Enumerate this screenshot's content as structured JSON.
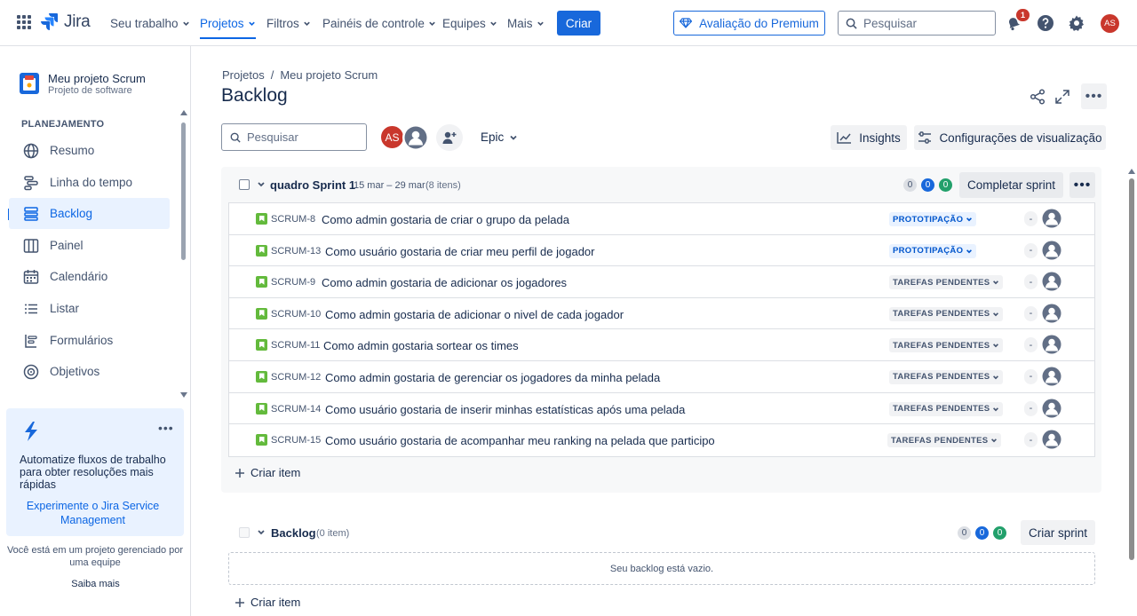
{
  "topnav": {
    "logo_text": "Jira",
    "items": [
      {
        "label": "Seu trabalho"
      },
      {
        "label": "Projetos"
      },
      {
        "label": "Filtros"
      },
      {
        "label": "Painéis de controle"
      },
      {
        "label": "Equipes"
      },
      {
        "label": "Mais"
      }
    ],
    "create_label": "Criar",
    "premium_label": "Avaliação do Premium",
    "search_placeholder": "Pesquisar",
    "notification_count": "1",
    "avatar_initials": "AS",
    "accent_color": "#1868db"
  },
  "sidebar": {
    "project_name": "Meu projeto Scrum",
    "project_type": "Projeto de software",
    "section_title": "PLANEJAMENTO",
    "items": [
      {
        "label": "Resumo",
        "icon": "globe-icon"
      },
      {
        "label": "Linha do tempo",
        "icon": "timeline-icon"
      },
      {
        "label": "Backlog",
        "icon": "backlog-icon"
      },
      {
        "label": "Painel",
        "icon": "board-icon"
      },
      {
        "label": "Calendário",
        "icon": "calendar-icon"
      },
      {
        "label": "Listar",
        "icon": "list-icon"
      },
      {
        "label": "Formulários",
        "icon": "forms-icon"
      },
      {
        "label": "Objetivos",
        "icon": "target-icon"
      }
    ],
    "promo": {
      "title": "Automatize fluxos de trabalho para obter resoluções mais rápidas",
      "link": "Experimente o Jira Service Management"
    },
    "footer_text": "Você está em um projeto gerenciado por uma equipe",
    "footer_link": "Saiba mais"
  },
  "main": {
    "breadcrumb": [
      "Projetos",
      "Meu projeto Scrum"
    ],
    "breadcrumb_sep": "/",
    "title": "Backlog",
    "search_placeholder": "Pesquisar",
    "avatar_initials": "AS",
    "epic_label": "Epic",
    "insights_label": "Insights",
    "view_settings_label": "Configurações de visualização"
  },
  "sprint": {
    "name": "quadro Sprint 1",
    "dates": "15 mar – 29 mar",
    "count": "(8 itens)",
    "todo_count": "0",
    "progress_count": "0",
    "done_count": "0",
    "complete_label": "Completar sprint",
    "create_item_label": "Criar item",
    "issues": [
      {
        "key": "SCRUM-8",
        "summary": "Como admin gostaria de criar o grupo da pelada",
        "status": "PROTOTIPAÇÃO",
        "estimate": "-"
      },
      {
        "key": "SCRUM-13",
        "summary": "Como usuário gostaria de criar meu perfil de jogador",
        "status": "PROTOTIPAÇÃO",
        "estimate": "-"
      },
      {
        "key": "SCRUM-9",
        "summary": "Como admin gostaria de adicionar os jogadores",
        "status": "TAREFAS PENDENTES",
        "estimate": "-"
      },
      {
        "key": "SCRUM-10",
        "summary": "Como admin gostaria de adicionar o nivel de cada jogador",
        "status": "TAREFAS PENDENTES",
        "estimate": "-"
      },
      {
        "key": "SCRUM-11",
        "summary": "Como admin gostaria sortear os times",
        "status": "TAREFAS PENDENTES",
        "estimate": "-"
      },
      {
        "key": "SCRUM-12",
        "summary": "Como admin gostaria de gerenciar os jogadores da minha pelada",
        "status": "TAREFAS PENDENTES",
        "estimate": "-"
      },
      {
        "key": "SCRUM-14",
        "summary": "Como usuário gostaria de inserir minhas estatísticas após uma pelada",
        "status": "TAREFAS PENDENTES",
        "estimate": "-"
      },
      {
        "key": "SCRUM-15",
        "summary": "Como usuário gostaria de acompanhar meu ranking na pelada que participo",
        "status": "TAREFAS PENDENTES",
        "estimate": "-"
      }
    ]
  },
  "backlog": {
    "title": "Backlog",
    "count": "(0 item)",
    "todo_count": "0",
    "progress_count": "0",
    "done_count": "0",
    "create_sprint_label": "Criar sprint",
    "empty_text": "Seu backlog está vazio.",
    "create_item_label": "Criar item"
  }
}
